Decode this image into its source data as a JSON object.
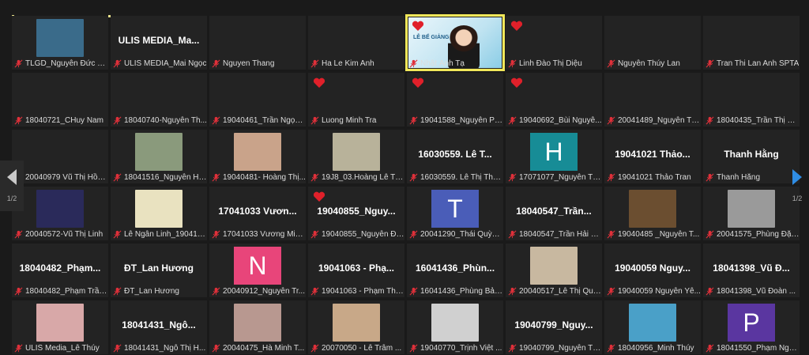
{
  "pager": {
    "left_page": "1/2",
    "right_page": "1/2"
  },
  "colors": {
    "active_border": "#f2e85a",
    "heart": "#e0202a",
    "mic_off": "#e0303a"
  },
  "tiles": [
    {
      "footer": "TLGD_Nguyễn Đức Gi...",
      "photo": "#3a6b8a",
      "big": ""
    },
    {
      "footer": "ULIS MEDIA_Mai Ngọc",
      "big": "ULIS MEDIA_Ma..."
    },
    {
      "footer": "Nguyen Thang",
      "big": ""
    },
    {
      "footer": "Ha Le Kim Anh",
      "big": ""
    },
    {
      "footer": "Nhật Ánh Tạ",
      "video": true,
      "slide_title": "LỄ BẾ GIẢNG",
      "heart": true,
      "big": ""
    },
    {
      "footer": "Linh Đào Thị Diệu",
      "heart": true,
      "big": ""
    },
    {
      "footer": "Nguyễn Thúy Lan",
      "big": ""
    },
    {
      "footer": "Tran Thi Lan Anh SPTA",
      "big": ""
    },
    {
      "footer": "18040721_CHuy Nam",
      "big": ""
    },
    {
      "footer": "18040740-Nguyễn Th...",
      "big": ""
    },
    {
      "footer": "19040461_Trần Ngọc ...",
      "big": ""
    },
    {
      "footer": "Luong Minh Tra",
      "heart": true,
      "big": ""
    },
    {
      "footer": "19041588_Nguyễn Ph...",
      "heart": true,
      "big": ""
    },
    {
      "footer": "19040692_Bùi Nguyễ...",
      "heart": true,
      "big": ""
    },
    {
      "footer": "20041489_Nguyễn Th...",
      "big": ""
    },
    {
      "footer": "18040435_Trần Thị H...",
      "big": ""
    },
    {
      "footer": "20040979 Vũ Thị Hồn...",
      "big": ""
    },
    {
      "footer": "18041516_Nguyễn Hả...",
      "photo": "#8a9a7c",
      "big": ""
    },
    {
      "footer": "19040481- Hoàng Thị...",
      "photo": "#c9a38a",
      "big": ""
    },
    {
      "footer": "19J8_03.Hoàng Lê Th...",
      "photo": "#b8b29a",
      "big": ""
    },
    {
      "footer": "16030559. Lê Thị Thu...",
      "big": "16030559. Lê T..."
    },
    {
      "footer": "17071077_Nguyễn Th...",
      "letter": "H",
      "letter_color": "#178c96",
      "big": ""
    },
    {
      "footer": "19041021 Thảo Tran",
      "big": "19041021 Thảo..."
    },
    {
      "footer": "Thanh Hằng",
      "big": "Thanh Hằng"
    },
    {
      "footer": "20040572-Vũ Thị Linh",
      "photo": "#2a2a5a",
      "big": ""
    },
    {
      "footer": "Lê Ngân Linh_190417...",
      "photo": "#e9e2c0",
      "big": ""
    },
    {
      "footer": "17041033 Vương Min...",
      "big": "17041033 Vươn..."
    },
    {
      "footer": "19040855_Nguyễn Đi...",
      "heart": true,
      "big": "19040855_Nguy..."
    },
    {
      "footer": "20041290_Thái Quỳnh...",
      "letter": "T",
      "letter_color": "#4a5db8",
      "big": ""
    },
    {
      "footer": "18040547_Trần Hải Chi",
      "big": "18040547_Trần..."
    },
    {
      "footer": "19040485 _Nguyễn T...",
      "photo": "#6b4e30",
      "big": ""
    },
    {
      "footer": "20041575_Phùng Đặn...",
      "photo": "#9a9a9a",
      "big": ""
    },
    {
      "footer": "18040482_Phạm Trần ...",
      "big": "18040482_Phạm..."
    },
    {
      "footer": "ĐT_Lan Hương",
      "big": "ĐT_Lan Hương"
    },
    {
      "footer": "20040912_Nguyễn Tr...",
      "letter": "N",
      "letter_color": "#e8457a",
      "big": ""
    },
    {
      "footer": "19041063 - Phạm Thị ...",
      "big": "19041063 - Phạ..."
    },
    {
      "footer": "16041436_Phùng Bảo...",
      "big": "16041436_Phùn..."
    },
    {
      "footer": "20040517_Lê Thị Quỳ...",
      "photo": "#c8b8a0",
      "big": ""
    },
    {
      "footer": "19040059 Nguyễn Yê...",
      "big": "19040059 Nguy..."
    },
    {
      "footer": "18041398_Vũ Đoàn ...",
      "big": "18041398_Vũ Đ..."
    },
    {
      "footer": "ULIS Media_Lê Thúy",
      "photo": "#d8a8a8",
      "big": ""
    },
    {
      "footer": "18041431_Ngô Thị H...",
      "big": "18041431_Ngô..."
    },
    {
      "footer": "20040475_Hà Minh T...",
      "photo": "#b89890",
      "big": ""
    },
    {
      "footer": "20070050 - Lê Trâm ...",
      "photo": "#c8a888",
      "big": ""
    },
    {
      "footer": "19040770_Trịnh Việt ...",
      "photo": "#d0d0d0",
      "big": ""
    },
    {
      "footer": "19040799_Nguyễn Th...",
      "big": "19040799_Nguy..."
    },
    {
      "footer": "18040956_Minh Thúy",
      "photo": "#4aa0c8",
      "big": ""
    },
    {
      "footer": "18041550_Phạm Ngo...",
      "letter": "P",
      "letter_color": "#5a36a0",
      "big": ""
    }
  ]
}
